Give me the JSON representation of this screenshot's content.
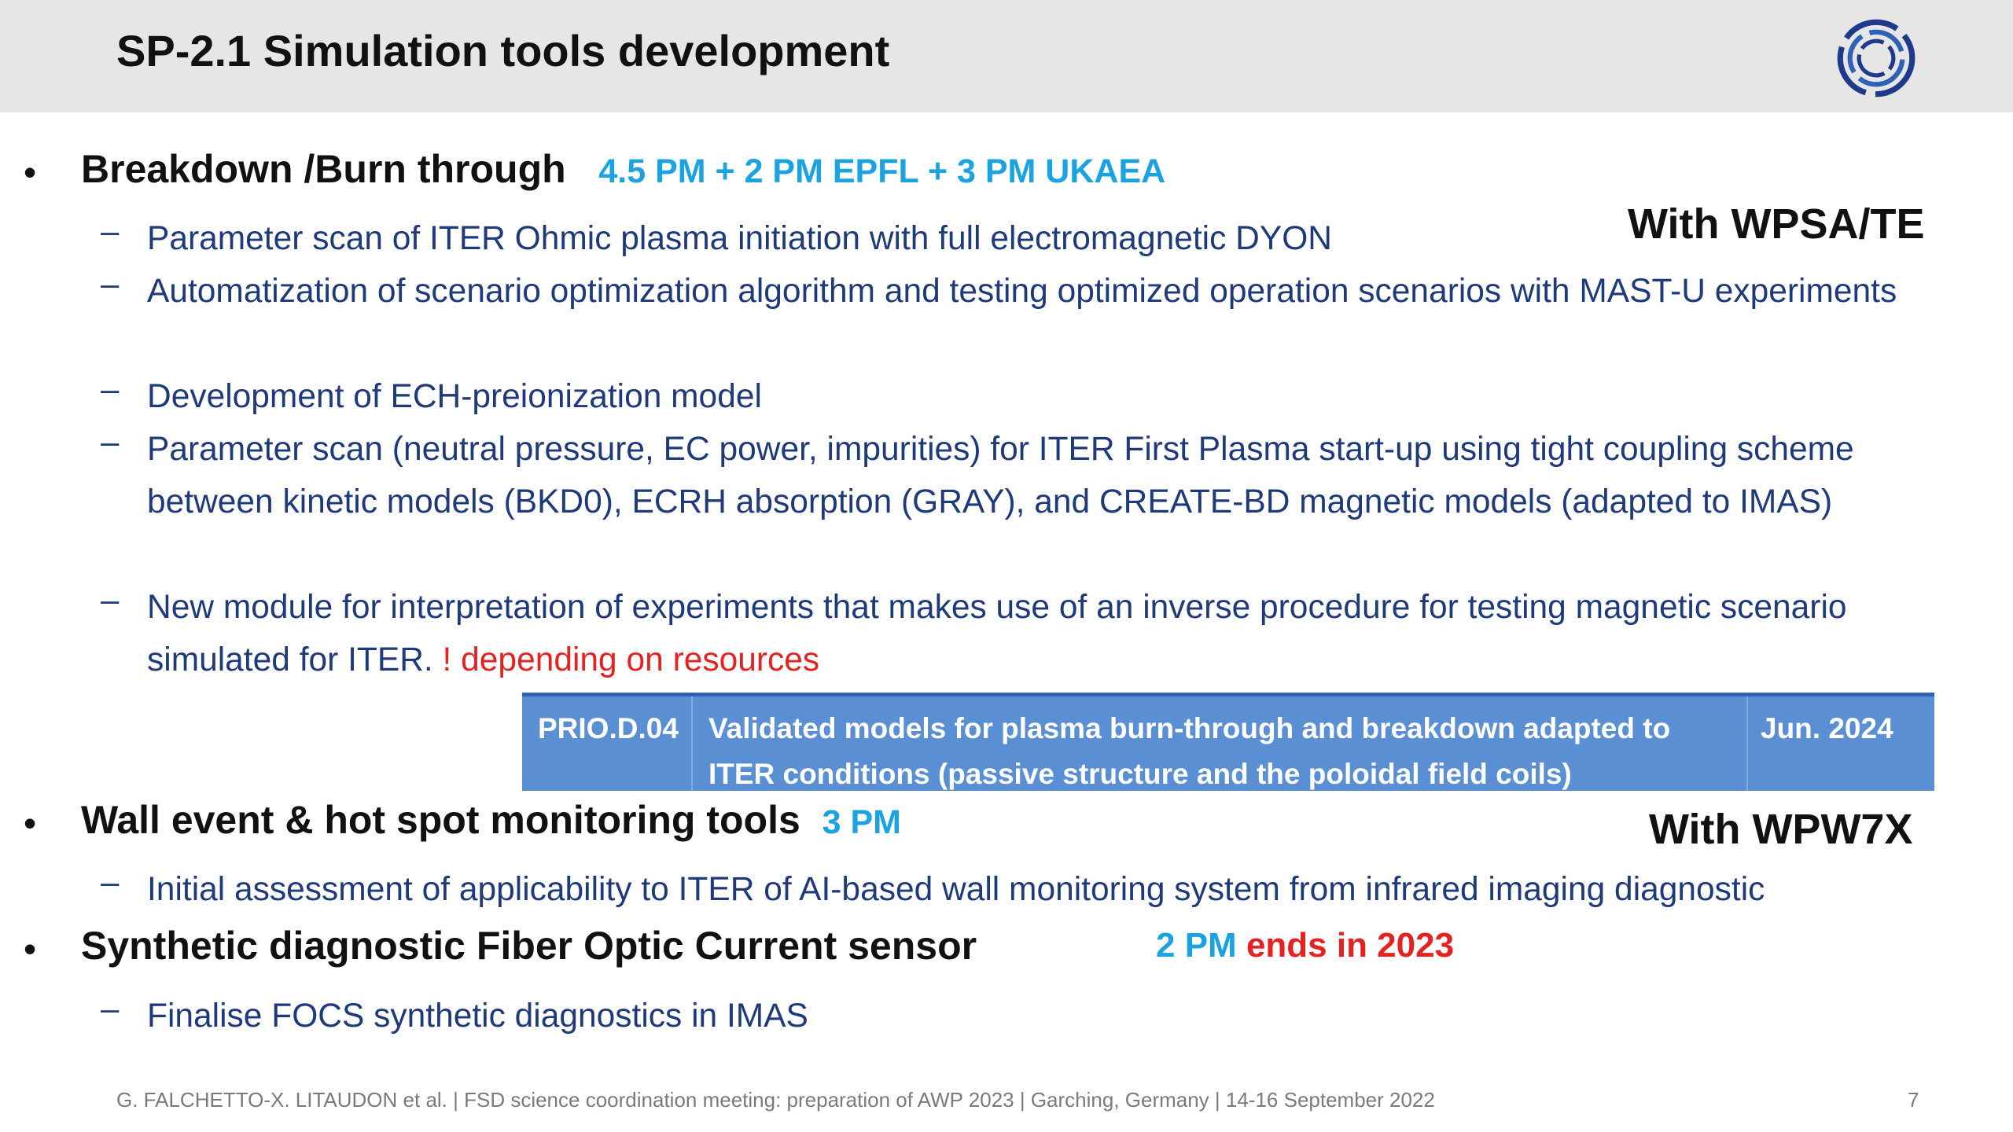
{
  "header": {
    "title": "SP-2.1 Simulation tools development",
    "logo_icon": "eurofusion-ring-logo"
  },
  "sections": {
    "breakdown": {
      "title": "Breakdown /Burn through",
      "resources": "4.5 PM + 2 PM EPFL + 3 PM UKAEA",
      "with": "With WPSA/TE",
      "items": [
        "Parameter scan of ITER Ohmic plasma initiation with full electromagnetic DYON",
        "Automatization of scenario optimization algorithm and testing optimized operation scenarios with MAST-U experiments",
        "Development of ECH-preionization model",
        "Parameter scan (neutral pressure, EC power, impurities) for ITER First Plasma start-up using tight coupling scheme between kinetic models (BKD0), ECRH absorption (GRAY), and CREATE-BD magnetic models (adapted to IMAS)",
        "New module for interpretation of experiments that makes use of an inverse procedure for testing magnetic scenario simulated for ITER."
      ],
      "item5_note": "! depending on resources",
      "prio": {
        "id": "PRIO.D.04",
        "text": "Validated models for plasma burn-through and breakdown adapted to ITER conditions (passive structure and the poloidal field coils)",
        "date": "Jun. 2024"
      }
    },
    "wall": {
      "title": "Wall event & hot spot monitoring tools",
      "resources": "3 PM",
      "with": "With WPW7X",
      "items": [
        "Initial assessment of applicability to ITER of AI-based wall monitoring system from infrared imaging diagnostic"
      ]
    },
    "fiber": {
      "title": "Synthetic diagnostic Fiber Optic Current sensor",
      "resources": "2 PM",
      "note": "ends in 2023",
      "items": [
        "Finalise FOCS synthetic diagnostics in IMAS"
      ]
    }
  },
  "footer": {
    "text": "G. FALCHETTO-X. LITAUDON et al. | FSD science coordination meeting: preparation of AWP 2023 | Garching, Germany |  14-16 September 2022",
    "page": "7"
  },
  "colors": {
    "accent": "#1aa3e0",
    "warning": "#e32222",
    "subtext": "#1f3a7a",
    "table": "#5b8fd4"
  },
  "bullet_glyph": "•",
  "dash_glyph": "–"
}
